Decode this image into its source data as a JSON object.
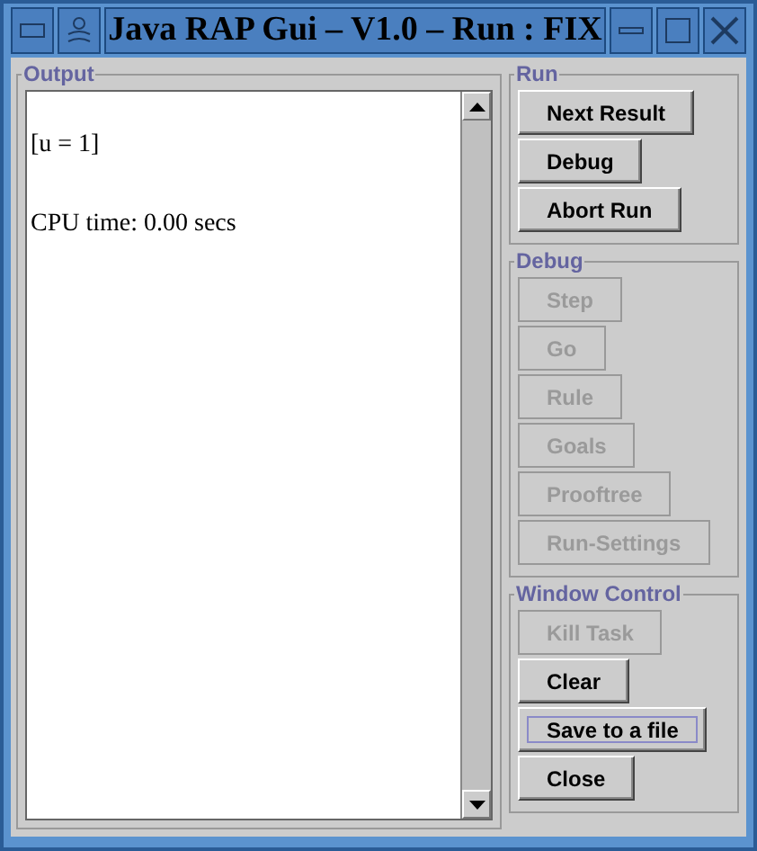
{
  "window": {
    "title": "Java RAP Gui – V1.0 – Run : FIX"
  },
  "output": {
    "label": "Output",
    "lines": [
      "[u = 1]",
      "CPU time: 0.00 secs"
    ]
  },
  "groups": [
    {
      "label": "Run",
      "buttons": [
        {
          "label": "Next Result",
          "disabled": false,
          "focused": false
        },
        {
          "label": "Debug",
          "disabled": false,
          "focused": false
        },
        {
          "label": "Abort Run",
          "disabled": false,
          "focused": false
        }
      ]
    },
    {
      "label": "Debug",
      "buttons": [
        {
          "label": "Step",
          "disabled": true,
          "focused": false
        },
        {
          "label": "Go",
          "disabled": true,
          "focused": false
        },
        {
          "label": "Rule",
          "disabled": true,
          "focused": false
        },
        {
          "label": "Goals",
          "disabled": true,
          "focused": false
        },
        {
          "label": "Prooftree",
          "disabled": true,
          "focused": false
        },
        {
          "label": "Run-Settings",
          "disabled": true,
          "focused": false
        }
      ]
    },
    {
      "label": "Window Control",
      "buttons": [
        {
          "label": "Kill Task",
          "disabled": true,
          "focused": false
        },
        {
          "label": "Clear",
          "disabled": false,
          "focused": false
        },
        {
          "label": "Save to a file",
          "disabled": false,
          "focused": true
        },
        {
          "label": "Close",
          "disabled": false,
          "focused": false
        }
      ]
    }
  ]
}
